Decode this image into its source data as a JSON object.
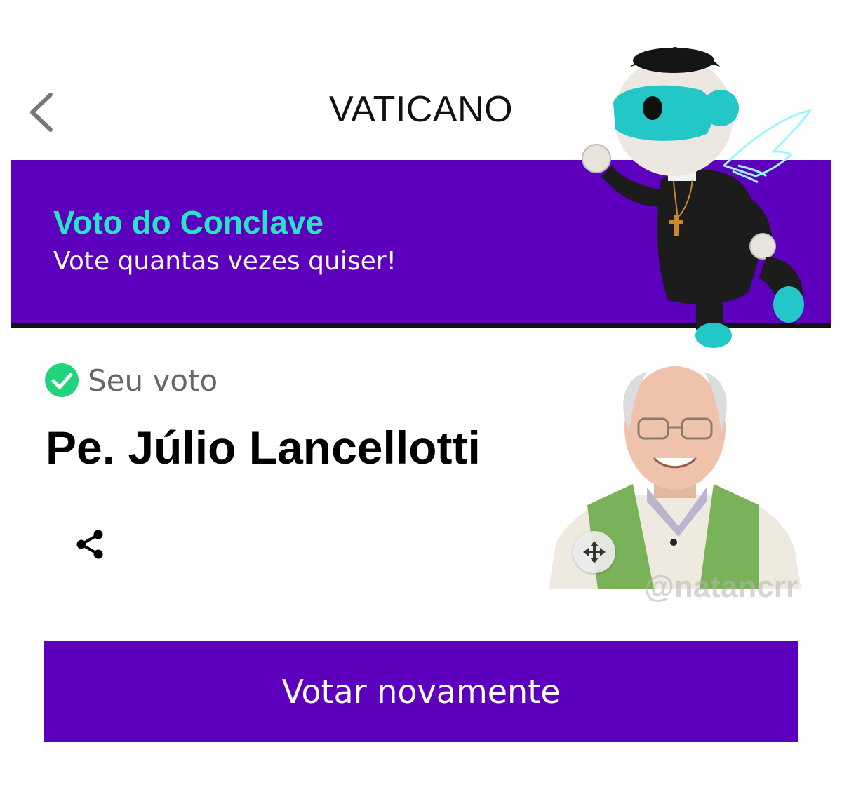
{
  "header": {
    "title": "VATICANO",
    "back_icon": "chevron-left-icon"
  },
  "banner": {
    "title": "Voto do Conclave",
    "subtitle": "Vote quantas vezes quiser!",
    "title_color": "#24e6c4",
    "background_color": "#5c00bd",
    "mascot": "flying-robot-priest-mascot"
  },
  "vote": {
    "status_icon": "check-circle-icon",
    "status_label": "Seu voto",
    "candidate_name": "Pe. Júlio Lancellotti",
    "share_icon": "share-icon",
    "photo": "candidate-photo",
    "move_icon": "move-arrows-icon",
    "watermark": "@natancrr"
  },
  "actions": {
    "vote_again_label": "Votar novamente",
    "button_color": "#5c00bd"
  }
}
